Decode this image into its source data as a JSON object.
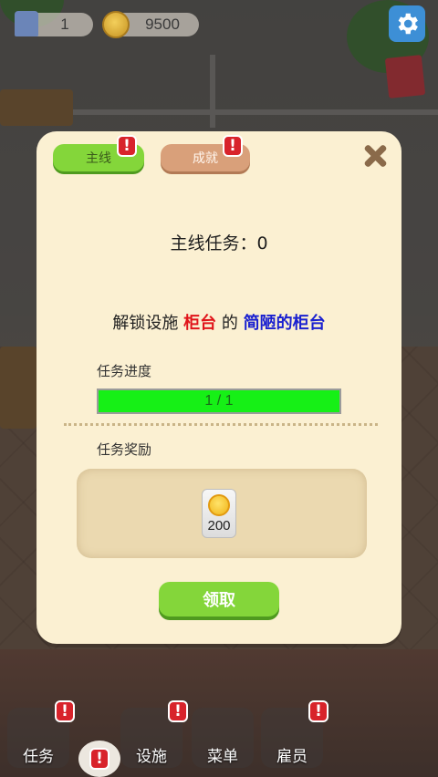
{
  "hud": {
    "level": "1",
    "coins": "9500"
  },
  "dialog": {
    "tabs": [
      {
        "label": "主线"
      },
      {
        "label": "成就"
      }
    ],
    "badge_mark": "!",
    "title": "主线任务：0",
    "description": {
      "prefix": "解锁设施",
      "target": "柜台",
      "middle": "的",
      "item": "简陋的柜台"
    },
    "progress": {
      "label": "任务进度",
      "text": "1 / 1",
      "fraction": 1.0,
      "fill_color": "#16f016"
    },
    "reward": {
      "label": "任务奖励",
      "icon": "coin-icon",
      "amount": "200"
    },
    "claim_label": "领取"
  },
  "nav": {
    "items": [
      {
        "label": "任务"
      },
      {
        "label": "设施"
      },
      {
        "label": "菜单"
      },
      {
        "label": "雇员"
      }
    ]
  },
  "colors": {
    "dialog_bg": "#fbf0d2",
    "accent_green": "#84d63a",
    "alert_red": "#d8232b"
  }
}
